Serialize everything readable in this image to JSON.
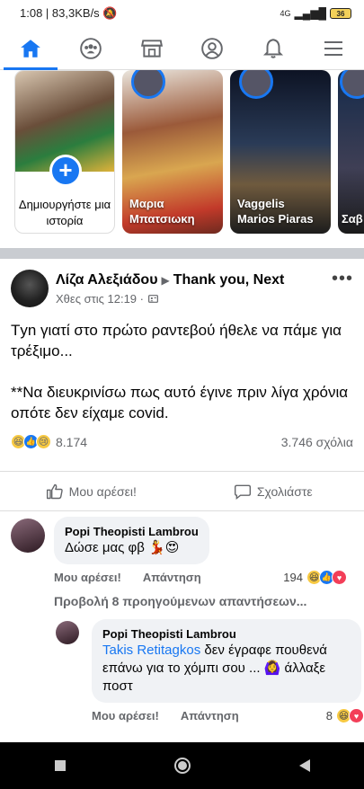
{
  "status": {
    "time": "1:08",
    "speed": "83,3KB/s",
    "network": "4G",
    "battery": "36"
  },
  "nav": {
    "items": [
      "home",
      "groups",
      "marketplace",
      "profile",
      "notifications",
      "menu"
    ]
  },
  "stories": {
    "create_label": "Δημιουργήστε μια ιστορία",
    "items": [
      {
        "name": "Μαρια Μπατσιωκη"
      },
      {
        "name": "Vaggelis Marios Piaras"
      },
      {
        "name": "Σαβ Φρα"
      }
    ]
  },
  "post": {
    "author": "Λίζα Αλεξιάδου",
    "group": "Thank you, Next",
    "time": "Χθες στις 12:19 ·",
    "paragraph1": "Τyn γιατί στο πρώτο ραντεβού ήθελε να πάμε για τρέξιμο...",
    "paragraph2": "**Να διευκρινίσω πως αυτό έγινε πριν λίγα χρόνια οπότε δεν είχαμε covid.",
    "reactions_count": "8.174",
    "comments_count": "3.746 σχόλια",
    "like_label": "Μου αρέσει!",
    "comment_label": "Σχολιάστε"
  },
  "comment1": {
    "name": "Popi Theopisti Lambrou",
    "text": "Δώσε μας φβ 💃😍",
    "like_label": "Μου αρέσει!",
    "reply_label": "Απάντηση",
    "reactions": "194"
  },
  "more_replies": "Προβολή 8 προηγούμενων απαντήσεων...",
  "reply1": {
    "name": "Popi Theopisti Lambrou",
    "mention": "Takis Retitagkos",
    "text": " δεν έγραφε πουθενά επάνω για το χόμπι σου ... 🙆‍♀️ άλλαξε ποστ",
    "like_label": "Μου αρέσει!",
    "reply_label": "Απάντηση",
    "reactions": "8"
  },
  "colors": {
    "accent": "#1877f2",
    "divider": "#c9ccd1",
    "muted": "#65676b"
  }
}
